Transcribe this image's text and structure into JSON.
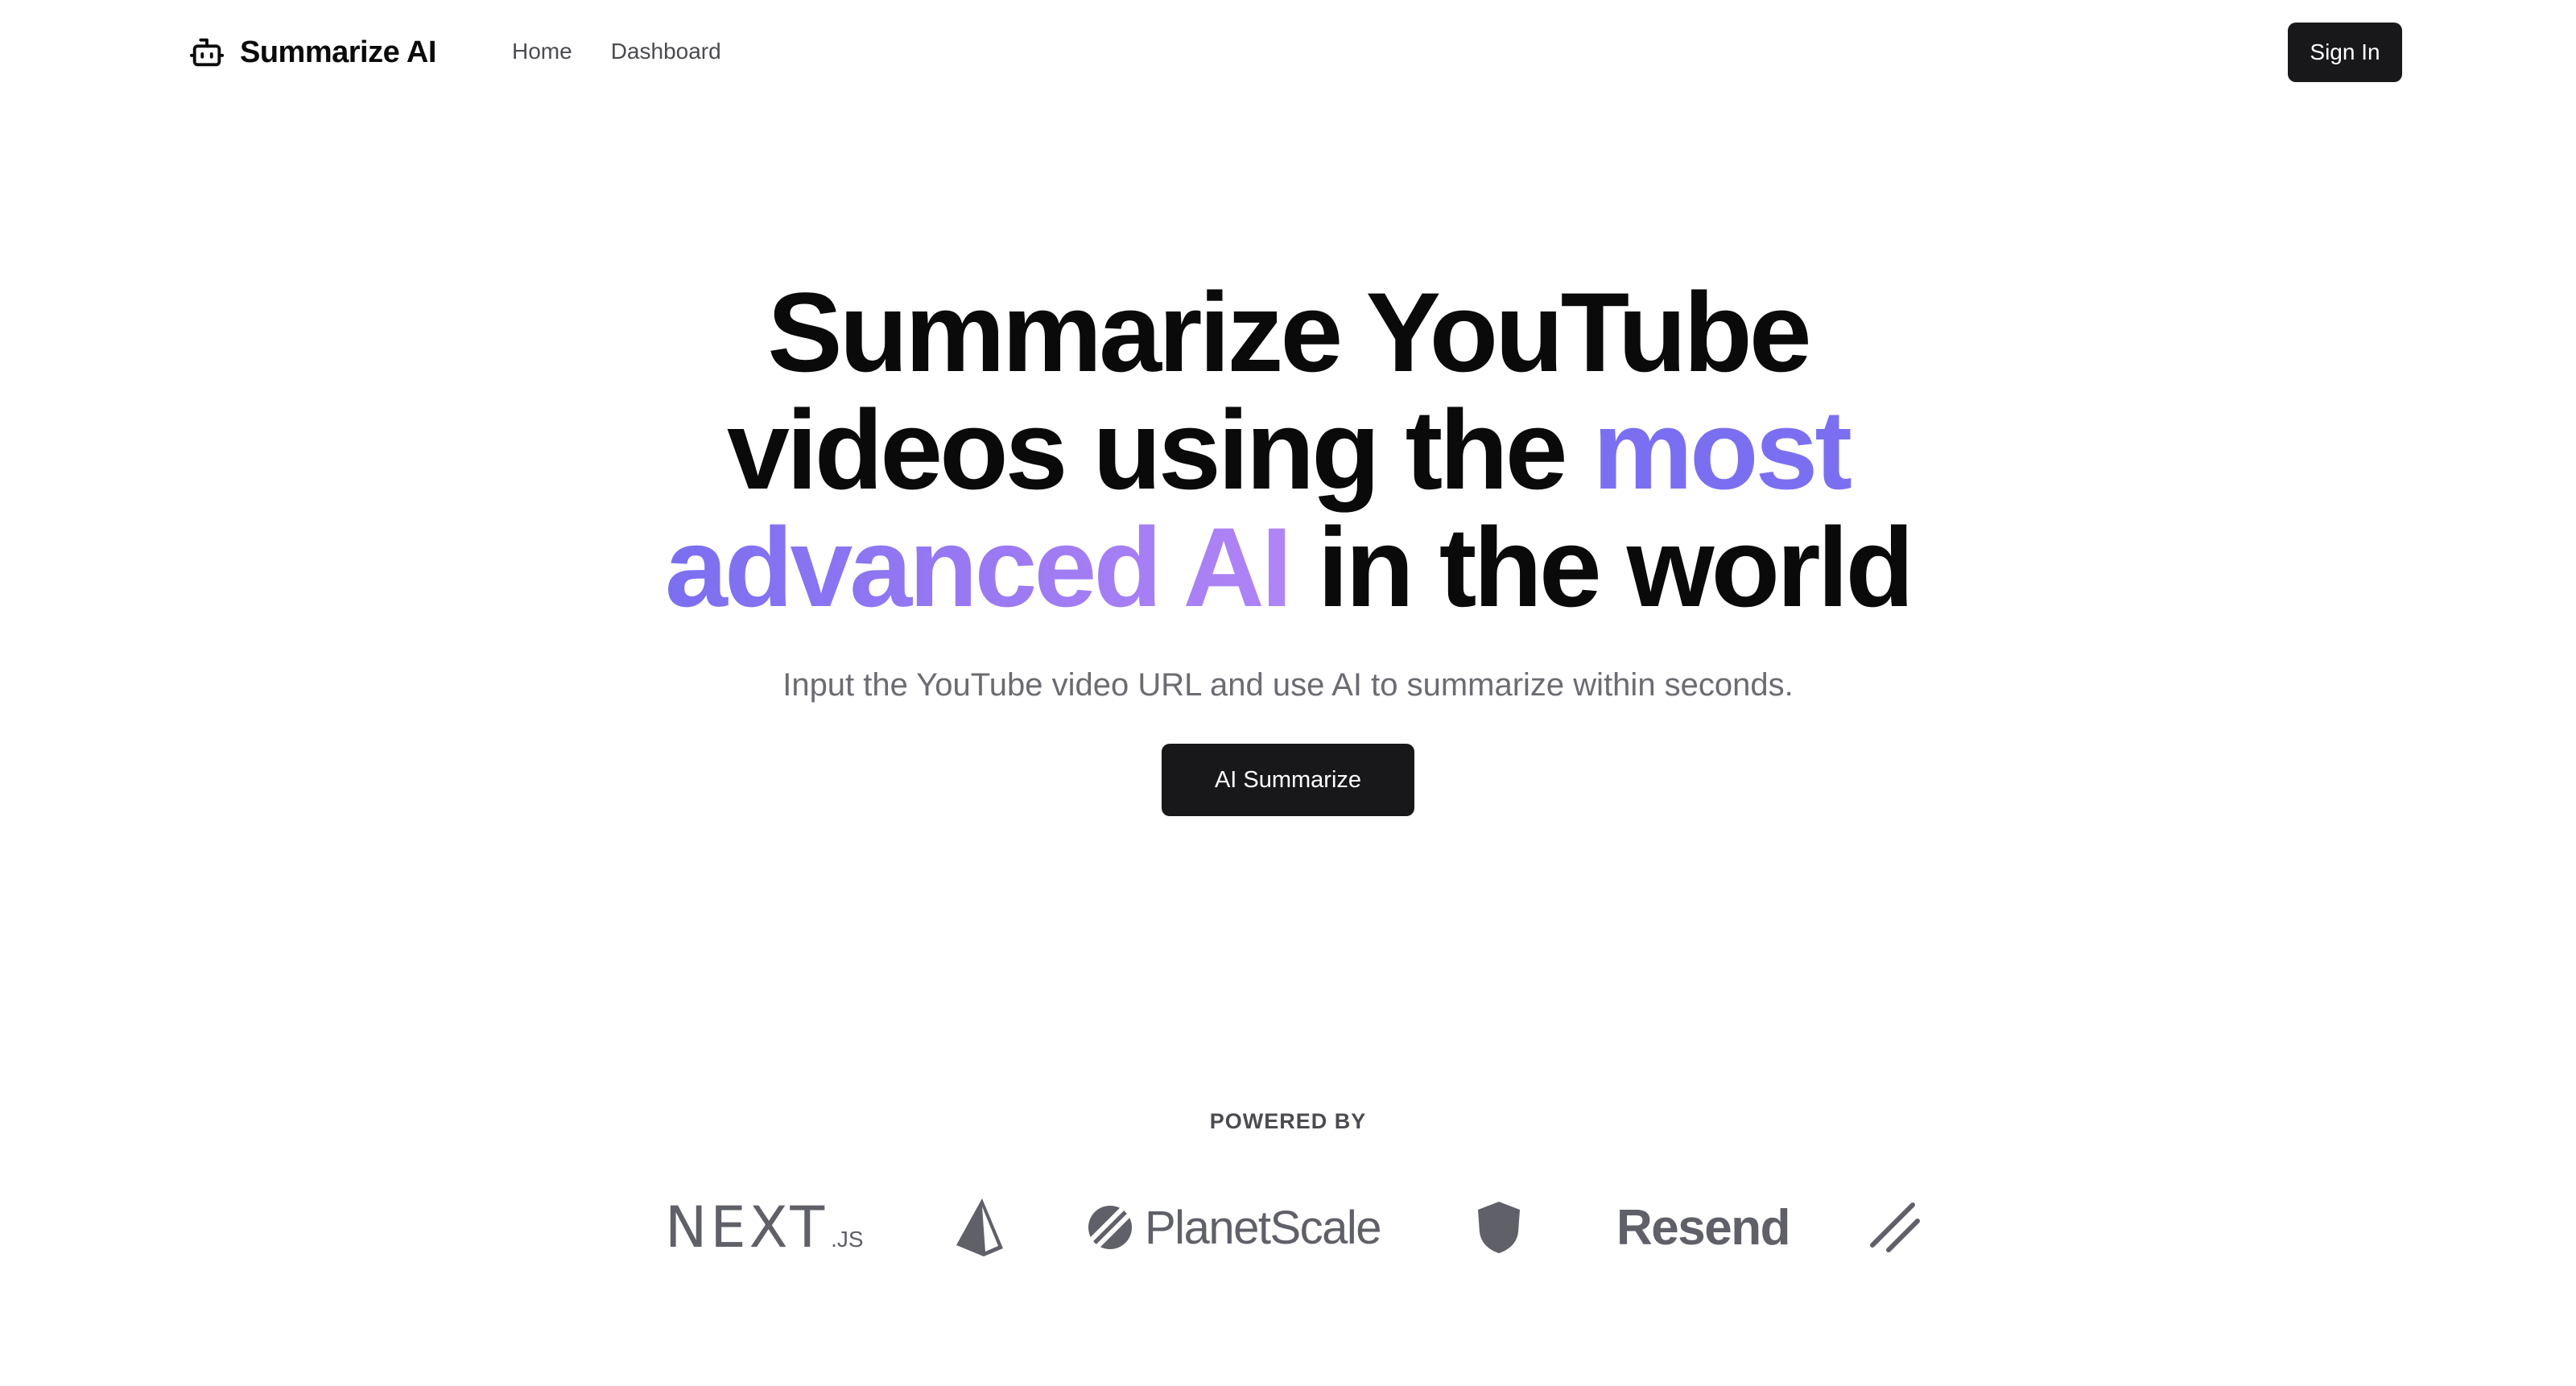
{
  "nav": {
    "brand_name": "Summarize AI",
    "brand_icon": "robot-icon",
    "links": [
      {
        "label": "Home"
      },
      {
        "label": "Dashboard"
      }
    ],
    "signin_label": "Sign In"
  },
  "hero": {
    "line1": "Summarize YouTube",
    "line2_plain": "videos using the ",
    "line2_accent": "most",
    "line3_accent": "advanced AI",
    "line3_plain": " in the world",
    "subtitle": "Input the YouTube video URL and use AI to summarize within seconds.",
    "cta_label": "AI Summarize"
  },
  "powered": {
    "label": "POWERED BY",
    "logos": [
      {
        "name": "nextjs-logo",
        "main": "NEXT",
        "sub": ".JS"
      },
      {
        "name": "prisma-logo"
      },
      {
        "name": "planetscale-logo",
        "text": "PlanetScale"
      },
      {
        "name": "nextauth-shield-logo"
      },
      {
        "name": "resend-logo",
        "text": "Resend"
      },
      {
        "name": "shadcn-logo"
      }
    ]
  },
  "colors": {
    "accent_start": "#7a6ff0",
    "accent_end": "#b084f5",
    "button_bg": "#18181b",
    "muted_text": "#6b6b72",
    "logo_gray": "#5f6068"
  }
}
